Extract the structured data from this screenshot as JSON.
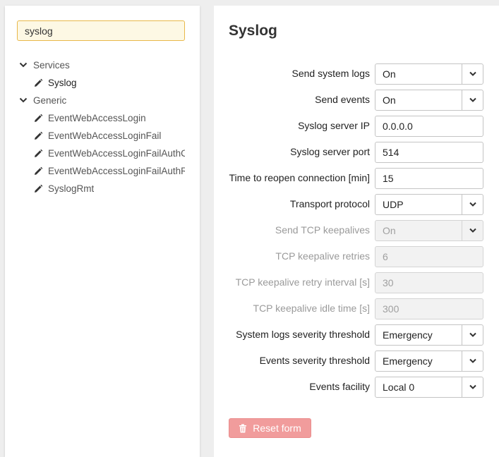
{
  "search": {
    "value": "syslog"
  },
  "tree": {
    "groups": [
      {
        "label": "Services",
        "items": [
          {
            "label": "Syslog"
          }
        ]
      },
      {
        "label": "Generic",
        "items": [
          {
            "label": "EventWebAccessLogin"
          },
          {
            "label": "EventWebAccessLoginFail"
          },
          {
            "label": "EventWebAccessLoginFailAuthC"
          },
          {
            "label": "EventWebAccessLoginFailAuthRe"
          },
          {
            "label": "SyslogRmt"
          }
        ]
      }
    ]
  },
  "form": {
    "title": "Syslog",
    "fields": [
      {
        "label": "Send system logs",
        "value": "On",
        "type": "select",
        "enabled": true
      },
      {
        "label": "Send events",
        "value": "On",
        "type": "select",
        "enabled": true
      },
      {
        "label": "Syslog server IP",
        "value": "0.0.0.0",
        "type": "input",
        "enabled": true
      },
      {
        "label": "Syslog server port",
        "value": "514",
        "type": "input",
        "enabled": true
      },
      {
        "label": "Time to reopen connection [min]",
        "value": "15",
        "type": "input",
        "enabled": true
      },
      {
        "label": "Transport protocol",
        "value": "UDP",
        "type": "select",
        "enabled": true
      },
      {
        "label": "Send TCP keepalives",
        "value": "On",
        "type": "select",
        "enabled": false
      },
      {
        "label": "TCP keepalive retries",
        "value": "6",
        "type": "input",
        "enabled": false
      },
      {
        "label": "TCP keepalive retry interval [s]",
        "value": "30",
        "type": "input",
        "enabled": false
      },
      {
        "label": "TCP keepalive idle time [s]",
        "value": "300",
        "type": "input",
        "enabled": false
      },
      {
        "label": "System logs severity threshold",
        "value": "Emergency",
        "type": "select",
        "enabled": true
      },
      {
        "label": "Events severity threshold",
        "value": "Emergency",
        "type": "select",
        "enabled": true
      },
      {
        "label": "Events facility",
        "value": "Local 0",
        "type": "select",
        "enabled": true
      }
    ],
    "reset_label": "Reset form"
  },
  "colors": {
    "search_border": "#e8b84a",
    "search_bg": "#fdf8e4",
    "reset_bg": "#f19c9c"
  }
}
